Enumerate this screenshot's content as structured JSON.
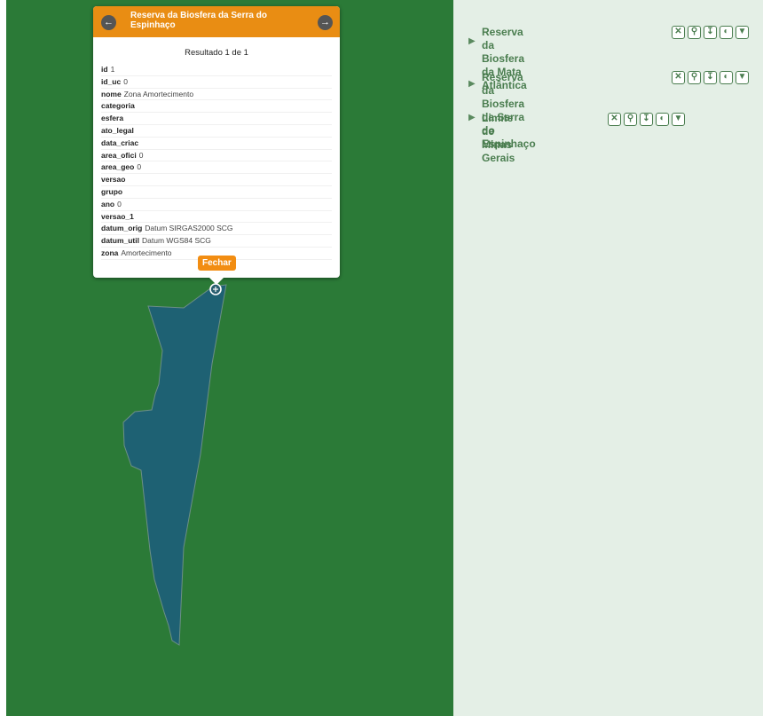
{
  "popup": {
    "title": "Reserva da Biosfera da Serra do Espinhaço",
    "prev_icon": "arrow-left-icon",
    "next_icon": "arrow-right-icon",
    "result": "Resultado 1 de 1",
    "attributes": [
      {
        "key": "id",
        "value": "1"
      },
      {
        "key": "id_uc",
        "value": "0"
      },
      {
        "key": "nome",
        "value": "Zona Amortecimento"
      },
      {
        "key": "categoria",
        "value": ""
      },
      {
        "key": "esfera",
        "value": ""
      },
      {
        "key": "ato_legal",
        "value": ""
      },
      {
        "key": "data_criac",
        "value": ""
      },
      {
        "key": "area_ofici",
        "value": "0"
      },
      {
        "key": "area_geo",
        "value": "0"
      },
      {
        "key": "versao",
        "value": ""
      },
      {
        "key": "grupo",
        "value": ""
      },
      {
        "key": "ano",
        "value": "0"
      },
      {
        "key": "versao_1",
        "value": ""
      },
      {
        "key": "datum_orig",
        "value": "Datum SIRGAS2000 SCG"
      },
      {
        "key": "datum_util",
        "value": "Datum WGS84 SCG"
      },
      {
        "key": "zona",
        "value": "Amortecimento"
      }
    ],
    "close_label": "Fechar"
  },
  "map": {
    "background_color": "#2b7a37",
    "polygon_fill": "#1e6173",
    "marker_icon": "location-marker-icon"
  },
  "layers": [
    {
      "line1": "Reserva da Biosfera da Mata",
      "line2": "Atlântica",
      "tools": [
        "remove-icon",
        "zoom-icon",
        "download-icon",
        "opacity-icon",
        "filter-icon"
      ]
    },
    {
      "line1": "Reserva da Biosfera da Serra do",
      "line2": "Espinhaço",
      "tools": [
        "remove-icon",
        "zoom-icon",
        "download-icon",
        "opacity-icon",
        "filter-icon"
      ]
    },
    {
      "line1": "Limite de Minas Gerais",
      "line2": "",
      "tools": [
        "remove-icon",
        "zoom-icon",
        "download-icon",
        "opacity-icon",
        "filter-icon"
      ]
    }
  ]
}
